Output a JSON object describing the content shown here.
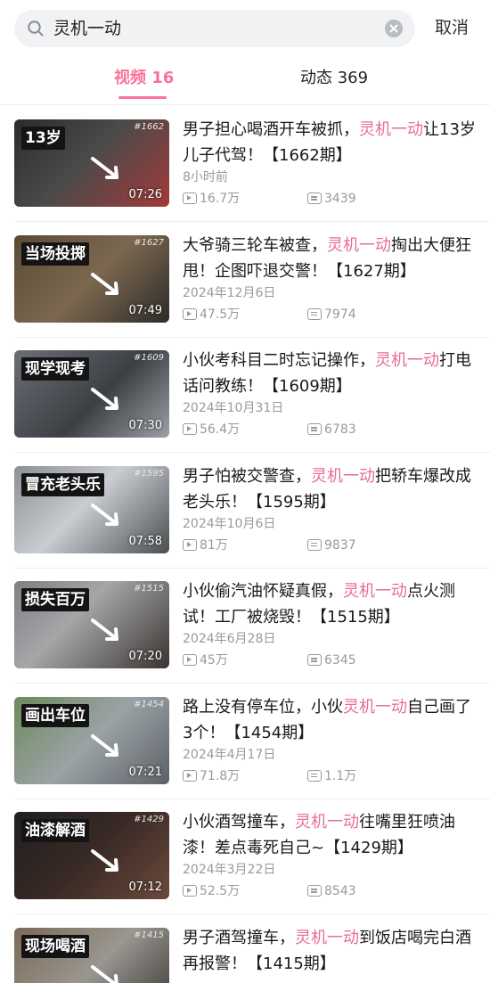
{
  "search": {
    "query": "灵机一动",
    "cancel_label": "取消"
  },
  "tabs": [
    {
      "label": "视频 16",
      "active": true
    },
    {
      "label": "动态 369",
      "active": false
    }
  ],
  "colors": {
    "accent": "#fb7299",
    "highlight": "#e86c96",
    "meta_gray": "#9a9a9a"
  },
  "videos": [
    {
      "title_before": "男子担心喝酒开车被抓，",
      "keyword": "灵机一动",
      "title_after": "让13岁儿子代驾！【1662期】",
      "date": "8小时前",
      "views": "16.7万",
      "danmaku": "3439",
      "thumb_badge": "13岁",
      "thumb_issue": "#1662",
      "duration": "07:26"
    },
    {
      "title_before": "大爷骑三轮车被查，",
      "keyword": "灵机一动",
      "title_after": "掏出大便狂甩！企图吓退交警！【1627期】",
      "date": "2024年12月6日",
      "views": "47.5万",
      "danmaku": "7974",
      "thumb_badge": "当场投掷",
      "thumb_issue": "#1627",
      "duration": "07:49"
    },
    {
      "title_before": "小伙考科目二时忘记操作，",
      "keyword": "灵机一动",
      "title_after": "打电话问教练！【1609期】",
      "date": "2024年10月31日",
      "views": "56.4万",
      "danmaku": "6783",
      "thumb_badge": "现学现考",
      "thumb_issue": "#1609",
      "duration": "07:30"
    },
    {
      "title_before": "男子怕被交警查，",
      "keyword": "灵机一动",
      "title_after": "把轿车爆改成老头乐！【1595期】",
      "date": "2024年10月6日",
      "views": "81万",
      "danmaku": "9837",
      "thumb_badge": "冒充老头乐",
      "thumb_issue": "#1595",
      "duration": "07:58"
    },
    {
      "title_before": "小伙偷汽油怀疑真假，",
      "keyword": "灵机一动",
      "title_after": "点火测试！工厂被烧毁！【1515期】",
      "date": "2024年6月28日",
      "views": "45万",
      "danmaku": "6345",
      "thumb_badge": "损失百万",
      "thumb_issue": "#1515",
      "duration": "07:20"
    },
    {
      "title_before": "路上没有停车位，小伙",
      "keyword": "灵机一动",
      "title_after": "自己画了3个！【1454期】",
      "date": "2024年4月17日",
      "views": "71.8万",
      "danmaku": "1.1万",
      "thumb_badge": "画出车位",
      "thumb_issue": "#1454",
      "duration": "07:21"
    },
    {
      "title_before": "小伙酒驾撞车，",
      "keyword": "灵机一动",
      "title_after": "往嘴里狂喷油漆！差点毒死自己~【1429期】",
      "date": "2024年3月22日",
      "views": "52.5万",
      "danmaku": "8543",
      "thumb_badge": "油漆解酒",
      "thumb_issue": "#1429",
      "duration": "07:12"
    },
    {
      "title_before": "男子酒驾撞车，",
      "keyword": "灵机一动",
      "title_after": "到饭店喝完白酒再报警！【1415期】",
      "date": "",
      "views": "",
      "danmaku": "",
      "thumb_badge": "现场喝酒",
      "thumb_issue": "#1415",
      "duration": ""
    }
  ]
}
